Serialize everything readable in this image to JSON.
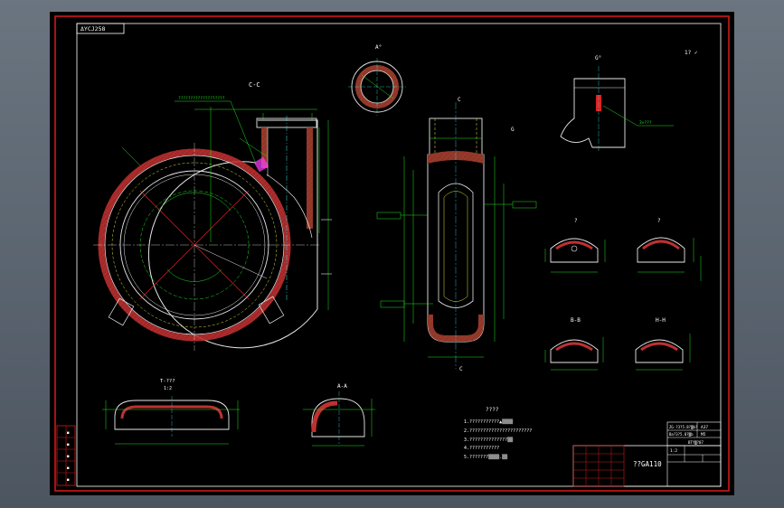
{
  "colors": {
    "background": "#000000",
    "frame": "#d01818",
    "inner_frame": "#ffffff",
    "outline": "#e8e8e8",
    "dimension": "#20e020",
    "centerline": "#e02020",
    "hatch": "#c03030",
    "wall_fill": "#8a3a28",
    "magenta": "#ff40ff",
    "cyan": "#40e0e0",
    "yellow": "#e0e040"
  },
  "drawing": {
    "code_box": "ΔYCJ258",
    "section_cc": "C-C",
    "view_a": "A°",
    "view_g": "G°",
    "marker_c": "C",
    "marker_g": "G",
    "section_bb": "B-B",
    "section_hh": "H-H",
    "section_aa": "A-A",
    "section_q1": "?",
    "section_q2": "?",
    "section_t": "T-???",
    "section_t_scale": "1:2",
    "roughness_note": "1?  ✓",
    "leader_note": "???????????????????",
    "leader_note_g": "3×???"
  },
  "notes": {
    "heading": "????",
    "lines": [
      "1.???????????▲▒▒▒▒",
      "2.???????????????????????",
      "3.??????????????▒▒",
      "4.???????????",
      "5.???????▒▒▒▒.▒▒"
    ]
  },
  "title_block": {
    "drawing_name": "??GA110",
    "top_cells": [
      "ZG·?3?5.8?▒b?",
      "A37",
      "Ba?3?5.8?▒b",
      "M5"
    ],
    "mid_cells": [
      "1:2",
      "",
      "BTY▒?07"
    ],
    "bottom_cells": [
      "",
      "",
      "",
      "",
      ""
    ]
  },
  "side_strip": [
    "■",
    "■",
    "■",
    "■",
    "■"
  ]
}
